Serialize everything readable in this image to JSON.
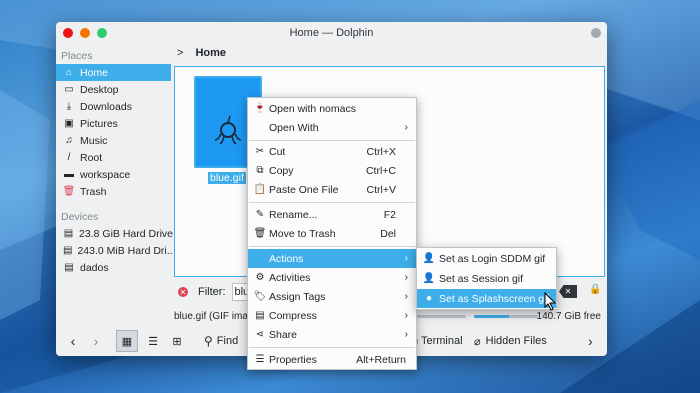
{
  "window": {
    "title": "Home — Dolphin"
  },
  "places": {
    "header": "Places",
    "items": [
      {
        "label": "Home",
        "icon": "home-icon"
      },
      {
        "label": "Desktop",
        "icon": "desktop-icon"
      },
      {
        "label": "Downloads",
        "icon": "download-icon"
      },
      {
        "label": "Pictures",
        "icon": "image-icon"
      },
      {
        "label": "Music",
        "icon": "music-icon"
      },
      {
        "label": "Root",
        "icon": "root-icon"
      },
      {
        "label": "workspace",
        "icon": "folder-icon"
      },
      {
        "label": "Trash",
        "icon": "trash-icon"
      }
    ]
  },
  "devices": {
    "header": "Devices",
    "items": [
      {
        "label": "23.8 GiB Hard Drive",
        "icon": "drive-icon"
      },
      {
        "label": "243.0 MiB Hard Dri...",
        "icon": "drive-icon"
      },
      {
        "label": "dados",
        "icon": "drive-icon"
      }
    ]
  },
  "breadcrumb": {
    "arrow": ">",
    "current": "Home"
  },
  "file": {
    "name": "blue.gif"
  },
  "filter": {
    "label": "Filter:",
    "value": "blu"
  },
  "status": {
    "text": "blue.gif (GIF imag",
    "free": "140.7 GiB free",
    "free_fraction": 0.55
  },
  "toolbar": {
    "find": "Find",
    "terminal": "n Terminal",
    "hidden": "Hidden Files"
  },
  "context_menu": {
    "open_with_app": "Open with nomacs",
    "open_with": "Open With",
    "cut": "Cut",
    "cut_key": "Ctrl+X",
    "copy": "Copy",
    "copy_key": "Ctrl+C",
    "paste": "Paste One File",
    "paste_key": "Ctrl+V",
    "rename": "Rename...",
    "rename_key": "F2",
    "trash": "Move to Trash",
    "trash_key": "Del",
    "actions": "Actions",
    "activities": "Activities",
    "tags": "Assign Tags",
    "compress": "Compress",
    "share": "Share",
    "properties": "Properties",
    "properties_key": "Alt+Return"
  },
  "submenu": {
    "login": "Set as Login SDDM gif",
    "session": "Set as Session gif",
    "splash": "Set as Splashscreen gif"
  },
  "colors": {
    "accent": "#3daee9",
    "close": "#ed1515",
    "min": "#f67400",
    "max": "#2ecc71"
  }
}
